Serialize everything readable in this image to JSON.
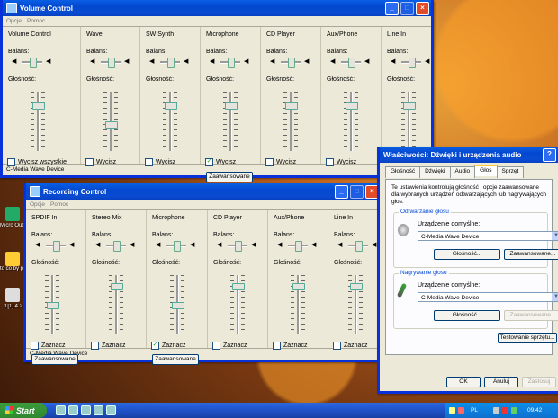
{
  "volume_control": {
    "title": "Volume Control",
    "menu": [
      "Opcje",
      "Pomoc"
    ],
    "balance_label": "Balans:",
    "volume_label": "Głośność:",
    "advanced_label": "Zaawansowane",
    "status": "C-Media Wave Device",
    "channels": [
      {
        "name": "Volume Control",
        "mute_label": "Wycisz wszystkie",
        "muted": false,
        "volume": 0.8
      },
      {
        "name": "Wave",
        "mute_label": "Wycisz",
        "muted": false,
        "volume": 0.45
      },
      {
        "name": "SW Synth",
        "mute_label": "Wycisz",
        "muted": false,
        "volume": 0.8
      },
      {
        "name": "Microphone",
        "mute_label": "Wycisz",
        "muted": true,
        "volume": 0.8
      },
      {
        "name": "CD Player",
        "mute_label": "Wycisz",
        "muted": false,
        "volume": 0.8
      },
      {
        "name": "Aux/Phone",
        "mute_label": "Wycisz",
        "muted": false,
        "volume": 0.8
      },
      {
        "name": "Line In",
        "mute_label": "Wycisz",
        "muted": false,
        "volume": 0.8
      }
    ]
  },
  "recording_control": {
    "title": "Recording Control",
    "menu": [
      "Opcje",
      "Pomoc"
    ],
    "balance_label": "Balans:",
    "volume_label": "Głośność:",
    "advanced_label": "Zaawansowane",
    "status": "C-Media Wave Device",
    "channels": [
      {
        "name": "SPDIF In",
        "select_label": "Zaznacz",
        "selected": false,
        "volume": 0.5
      },
      {
        "name": "Stereo Mix",
        "select_label": "Zaznacz",
        "selected": false,
        "volume": 0.85
      },
      {
        "name": "Microphone",
        "select_label": "Zaznacz",
        "selected": true,
        "volume": 0.5
      },
      {
        "name": "CD Player",
        "select_label": "Zaznacz",
        "selected": false,
        "volume": 0.85
      },
      {
        "name": "Aux/Phone",
        "select_label": "Zaznacz",
        "selected": false,
        "volume": 0.85
      },
      {
        "name": "Line In",
        "select_label": "Zaznacz",
        "selected": false,
        "volume": 0.85
      }
    ]
  },
  "properties": {
    "title": "Właściwości: Dźwięki i urządzenia audio",
    "tabs": [
      "Głośność",
      "Dźwięki",
      "Audio",
      "Głos",
      "Sprzęt"
    ],
    "active_tab": "Głos",
    "description": "Te ustawienia kontrolują głośność i opcje zaawansowane dla wybranych urządzeń odtwarzających lub nagrywających głos.",
    "playback_group": "Odtwarzanie głosu",
    "playback_device_label": "Urządzenie domyślne:",
    "playback_device": "C-Media Wave Device",
    "playback_volume_btn": "Głośność...",
    "playback_advanced_btn": "Zaawansowane...",
    "record_group": "Nagrywanie głosu",
    "record_device_label": "Urządzenie domyślne:",
    "record_device": "C-Media Wave Device",
    "record_volume_btn": "Głośność...",
    "record_advanced_btn": "Zaawansowane...",
    "test_btn": "Testowanie sprzętu...",
    "ok": "OK",
    "cancel": "Anuluj",
    "apply": "Zastosuj"
  },
  "desktop_icons": [
    {
      "label": "Micro Outlo"
    },
    {
      "label": "to co by pulpit"
    },
    {
      "label": "1[1].4.2"
    }
  ],
  "taskbar": {
    "start": "Start",
    "lang": "PL",
    "clock": "09:42"
  }
}
